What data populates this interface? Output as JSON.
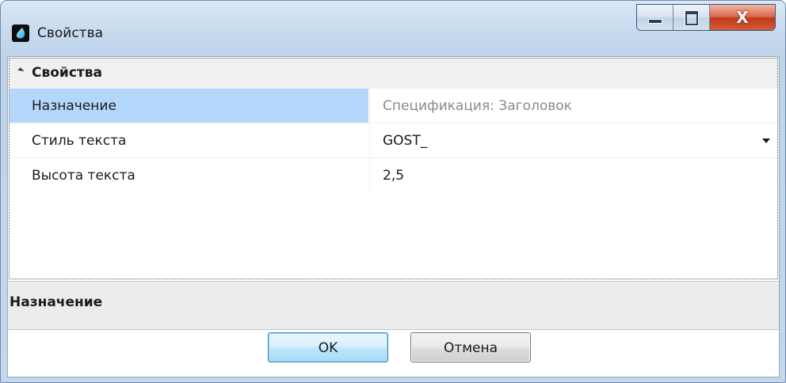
{
  "window": {
    "title": "Свойства",
    "icon": "drop-icon"
  },
  "caption_buttons": {
    "minimize": "minimize-icon",
    "maximize": "maximize-icon",
    "close_glyph": "X"
  },
  "property_grid": {
    "category": "Свойства",
    "rows": [
      {
        "name": "Назначение",
        "value": "Спецификация: Заголовок",
        "readonly": true,
        "selected": true
      },
      {
        "name": "Стиль текста",
        "value": "GOST_",
        "dropdown": true
      },
      {
        "name": "Высота текста",
        "value": "2,5"
      }
    ]
  },
  "description_panel": {
    "title": "Назначение"
  },
  "buttons": {
    "ok_label": "OK",
    "cancel_label": "Отмена"
  },
  "colors": {
    "selection": "#b3d7fb",
    "readonly_text": "#8a8a8a",
    "close_button": "#c3391c"
  }
}
